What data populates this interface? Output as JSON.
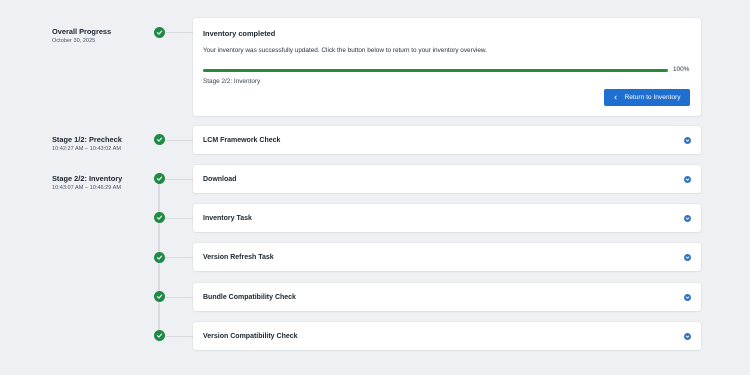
{
  "overall": {
    "title": "Overall Progress",
    "date": "October 30, 2025"
  },
  "main_card": {
    "title": "Inventory completed",
    "message": "Your inventory was successfully updated. Click the button below to return to your inventory overview.",
    "progress_percent": 100,
    "progress_label": "100%",
    "stage_text": "Stage 2/2: Inventory",
    "button_label": "Return to Inventory"
  },
  "stages": [
    {
      "title": "Stage 1/2: Precheck",
      "time": "10:42:27 AM – 10:43:02 AM"
    },
    {
      "title": "Stage 2/2: Inventory",
      "time": "10:43:07 AM – 10:46:29 AM"
    }
  ],
  "tasks": [
    {
      "label": "LCM Framework Check"
    },
    {
      "label": "Download"
    },
    {
      "label": "Inventory Task"
    },
    {
      "label": "Version Refresh Task"
    },
    {
      "label": "Bundle Compatibility Check"
    },
    {
      "label": "Version Compatibility Check"
    }
  ],
  "colors": {
    "success": "#1f8a45",
    "accent": "#1f6fd1",
    "progress": "#2a8a3a"
  },
  "icons": {
    "status": "check-circle-icon",
    "expand": "chevron-down-icon",
    "back": "chevron-left-icon"
  }
}
